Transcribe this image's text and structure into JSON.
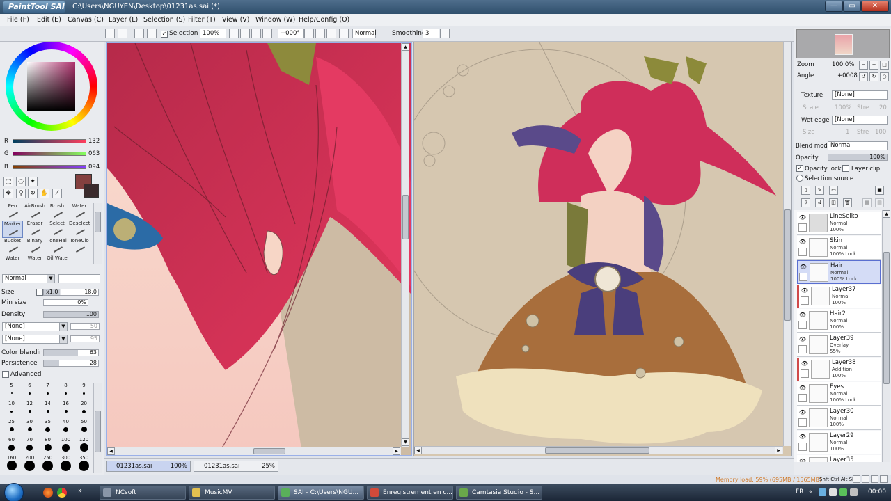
{
  "window": {
    "logo": "PaintTool SAI",
    "title": "C:\\Users\\NGUYEN\\Desktop\\01231as.sai (*)",
    "min": "—",
    "max": "▭",
    "close": "✕"
  },
  "menu": [
    "File (F)",
    "Edit (E)",
    "Canvas (C)",
    "Layer (L)",
    "Selection (S)",
    "Filter (T)",
    "View (V)",
    "Window (W)",
    "Help/Config (O)"
  ],
  "toolbar": {
    "selection_label": "Selection",
    "zoom": "100%",
    "angle": "+000°",
    "mode": "Normal",
    "smoothing_label": "Smoothing",
    "smoothing_value": "3"
  },
  "color": {
    "r_label": "R",
    "r_value": "132",
    "g_label": "G",
    "g_value": "063",
    "b_label": "B",
    "b_value": "094",
    "fg_hex": "#84403f",
    "bg_hex": "#3a2a2c"
  },
  "tools": {
    "brushes": [
      [
        "Pen",
        "AirBrush",
        "Brush",
        "Water"
      ],
      [
        "Marker",
        "Eraser",
        "Select",
        "Deselect"
      ],
      [
        "Bucket",
        "Binary",
        "ToneHal",
        "ToneClo"
      ],
      [
        "Water",
        "Water",
        "Oil Wate",
        ""
      ]
    ],
    "selected": "Marker"
  },
  "brush_props": {
    "blend": "Normal",
    "size_label": "Size",
    "size_mult": "x1.0",
    "size_value": "18.0",
    "min_size_label": "Min size",
    "min_size_value": "0%",
    "density_label": "Density",
    "density_value": "100",
    "tex1": "[None]",
    "tex1_val": "50",
    "tex2": "[None]",
    "tex2_val": "95",
    "color_blending_label": "Color blending",
    "color_blending_value": "63",
    "persistence_label": "Persistence",
    "persistence_value": "28",
    "advanced_label": "Advanced"
  },
  "brush_sizes": [
    "5",
    "6",
    "7",
    "8",
    "9",
    "10",
    "12",
    "14",
    "16",
    "20",
    "25",
    "30",
    "35",
    "40",
    "50",
    "60",
    "70",
    "80",
    "100",
    "120",
    "160",
    "200",
    "250",
    "300",
    "350"
  ],
  "view_tabs": [
    {
      "name": "01231as.sai",
      "zoom": "100%"
    },
    {
      "name": "01231as.sai",
      "zoom": "25%"
    }
  ],
  "navigator": {
    "zoom_label": "Zoom",
    "zoom_value": "100.0%",
    "angle_label": "Angle",
    "angle_value": "+0008"
  },
  "layer_props": {
    "texture_label": "Texture",
    "texture_value": "[None]",
    "texture_scale": "Scale",
    "texture_scale_val": "100%",
    "texture_str": "Stre",
    "texture_str_val": "20",
    "wet_label": "Wet edge",
    "wet_value": "[None]",
    "wet_size": "Size",
    "wet_size_val": "1",
    "wet_str": "Stre",
    "wet_str_val": "100",
    "blend_label": "Blend mode",
    "blend_value": "Normal",
    "opacity_label": "Opacity",
    "opacity_value": "100%",
    "opacity_lock": "Opacity lock",
    "layer_clip": "Layer clip",
    "selection_source": "Selection source"
  },
  "layers": [
    {
      "name": "LineSeiko",
      "mode": "Normal",
      "opacity": "100%",
      "folder": true
    },
    {
      "name": "Skin",
      "mode": "Normal",
      "opacity": "100% Lock"
    },
    {
      "name": "Hair",
      "mode": "Normal",
      "opacity": "100% Lock",
      "selected": true
    },
    {
      "name": "Layer37",
      "mode": "Normal",
      "opacity": "100%",
      "clip": true
    },
    {
      "name": "Hair2",
      "mode": "Normal",
      "opacity": "100%"
    },
    {
      "name": "Layer39",
      "mode": "Overlay",
      "opacity": "55%"
    },
    {
      "name": "Layer38",
      "mode": "Addition",
      "opacity": "100%",
      "clip": true
    },
    {
      "name": "Eyes",
      "mode": "Normal",
      "opacity": "100% Lock"
    },
    {
      "name": "Layer30",
      "mode": "Normal",
      "opacity": "100%"
    },
    {
      "name": "Layer29",
      "mode": "Normal",
      "opacity": "100%"
    },
    {
      "name": "Layer35",
      "mode": "",
      "opacity": ""
    }
  ],
  "status": {
    "memory": "Memory load: 59% (695MB / 1565MB)",
    "keys": "Shft Ctrl Alt SPC"
  },
  "taskbar": {
    "items": [
      "NCsoft",
      "MusicMV",
      "SAI - C:\\Users\\NGU...",
      "Enregistrement en c...",
      "Camtasia Studio - S..."
    ],
    "lang": "FR",
    "clock": "00:00"
  }
}
